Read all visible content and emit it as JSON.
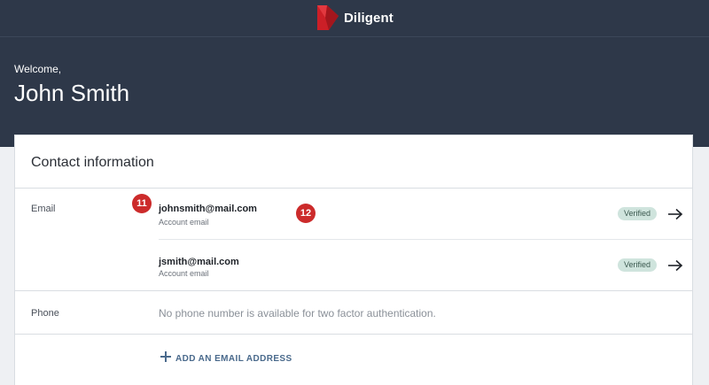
{
  "header": {
    "brand_name": "Diligent",
    "logo_icon": "diligent-logo-icon",
    "colors": {
      "header_bg": "#2e3849",
      "brand_red": "#cc1f27"
    }
  },
  "welcome": {
    "greeting": "Welcome,",
    "user_name": "John Smith"
  },
  "contact": {
    "title": "Contact information",
    "email_label": "Email",
    "emails": [
      {
        "address": "johnsmith@mail.com",
        "sub": "Account email",
        "status": "Verified"
      },
      {
        "address": "jsmith@mail.com",
        "sub": "Account email",
        "status": "Verified"
      }
    ],
    "phone_label": "Phone",
    "phone_message": "No phone number is available for two factor authentication.",
    "add_email_label": "ADD AN EMAIL ADDRESS"
  },
  "annotations": [
    "11",
    "12"
  ]
}
